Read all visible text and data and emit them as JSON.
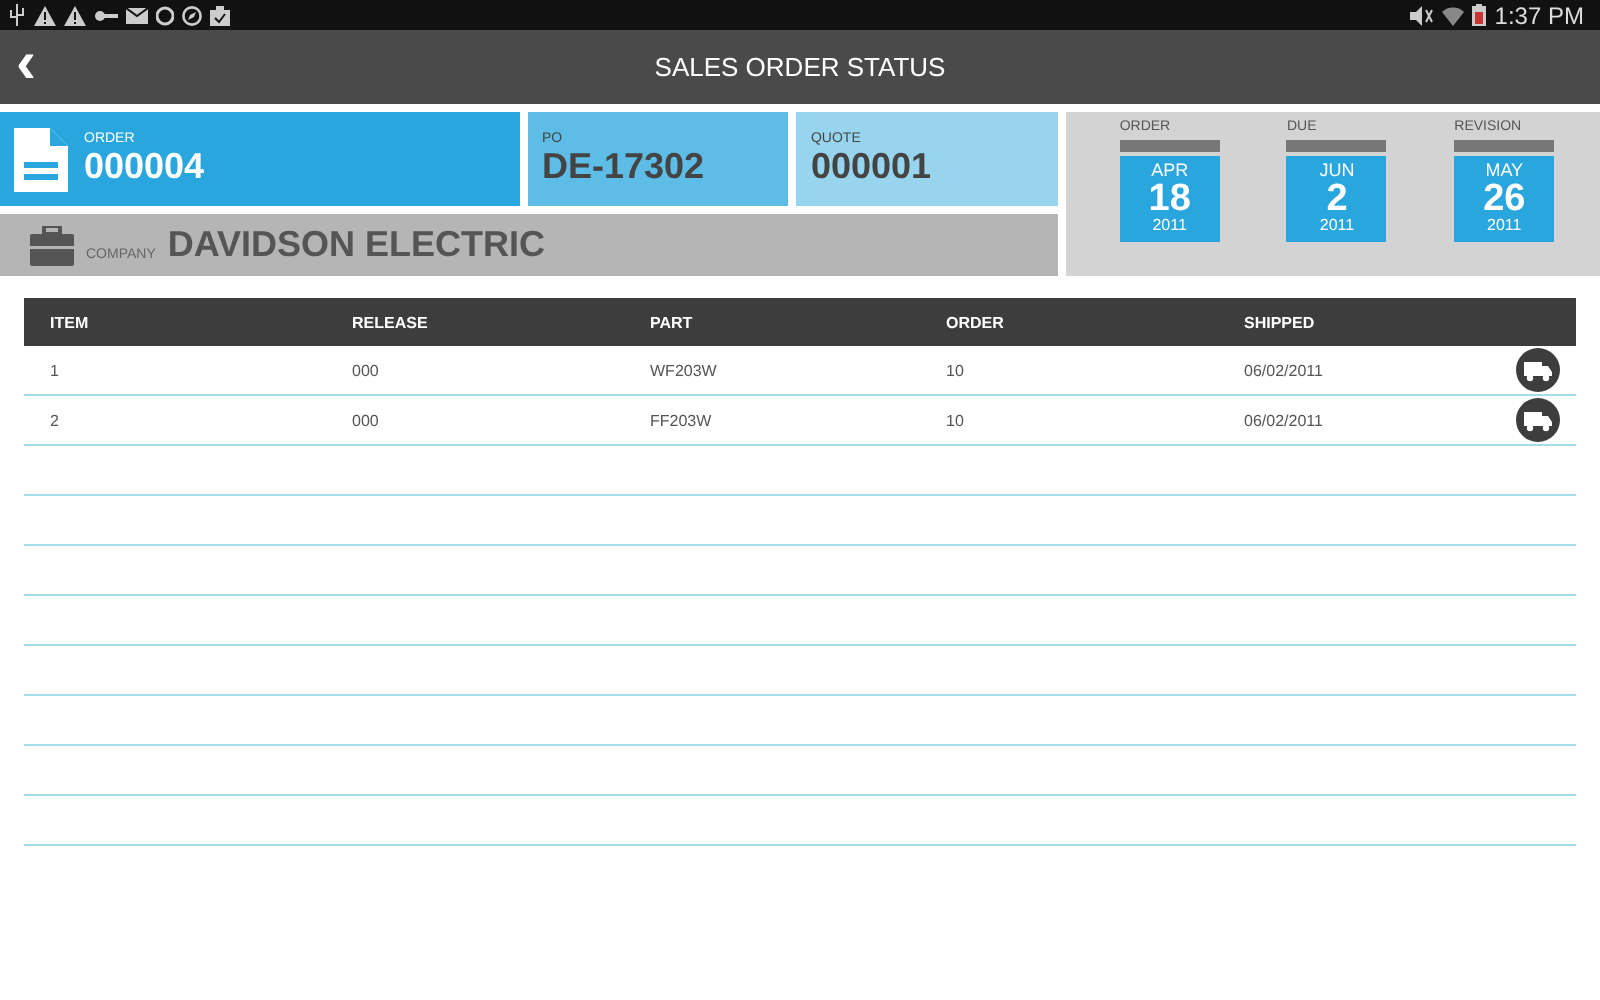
{
  "status_bar": {
    "time": "1:37 PM"
  },
  "app_bar": {
    "back": "‹",
    "title": "SALES ORDER STATUS"
  },
  "order": {
    "label": "ORDER",
    "value": "000004"
  },
  "po": {
    "label": "PO",
    "value": "DE-17302"
  },
  "quote": {
    "label": "QUOTE",
    "value": "000001"
  },
  "company": {
    "label": "COMPANY",
    "value": "DAVIDSON ELECTRIC"
  },
  "dates": [
    {
      "label": "ORDER",
      "month": "APR",
      "day": "18",
      "year": "2011"
    },
    {
      "label": "DUE",
      "month": "JUN",
      "day": "2",
      "year": "2011"
    },
    {
      "label": "REVISION",
      "month": "MAY",
      "day": "26",
      "year": "2011"
    }
  ],
  "table": {
    "columns": [
      "ITEM",
      "RELEASE",
      "PART",
      "ORDER",
      "SHIPPED"
    ],
    "rows": [
      {
        "cells": [
          "1",
          "000",
          "WF203W",
          "10",
          "06/02/2011"
        ],
        "kind": "shipped"
      },
      {
        "cells": [
          "2",
          "000",
          "FF203W",
          "10",
          "06/02/2011"
        ],
        "kind": "shipped"
      }
    ]
  }
}
